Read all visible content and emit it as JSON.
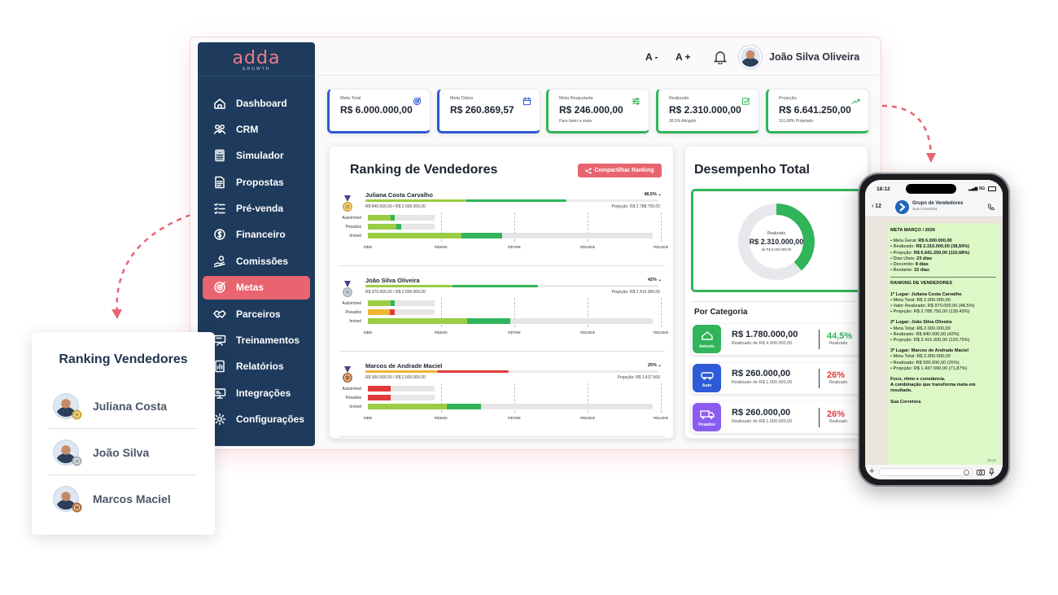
{
  "brand": {
    "name": "adda",
    "tagline": "GROWTH"
  },
  "sidebar": {
    "items": [
      {
        "label": "Dashboard",
        "icon": "home-icon"
      },
      {
        "label": "CRM",
        "icon": "users-icon"
      },
      {
        "label": "Simulador",
        "icon": "calculator-icon"
      },
      {
        "label": "Propostas",
        "icon": "document-icon"
      },
      {
        "label": "Pré-venda",
        "icon": "checklist-icon"
      },
      {
        "label": "Financeiro",
        "icon": "money-icon"
      },
      {
        "label": "Comissões",
        "icon": "hand-coin-icon"
      },
      {
        "label": "Metas",
        "icon": "target-icon",
        "active": true
      },
      {
        "label": "Parceiros",
        "icon": "handshake-icon"
      },
      {
        "label": "Treinamentos",
        "icon": "training-icon"
      },
      {
        "label": "Relatórios",
        "icon": "report-icon"
      },
      {
        "label": "Integrações",
        "icon": "integration-icon"
      },
      {
        "label": "Configurações",
        "icon": "gear-icon"
      }
    ]
  },
  "topbar": {
    "font_decrease": "A -",
    "font_increase": "A +",
    "user_name": "João Silva Oliveira"
  },
  "kpis": [
    {
      "label": "Meta Total",
      "value": "R$ 6.000.000,00",
      "sub": "",
      "icon": "target-icon",
      "accent": "#2d5bd7"
    },
    {
      "label": "Meta Diária",
      "value": "R$ 260.869,57",
      "sub": "",
      "icon": "calendar-icon",
      "accent": "#2d5bd7"
    },
    {
      "label": "Meta Reajustada",
      "value": "R$ 246.000,00",
      "sub": "Para bater a meta",
      "icon": "sliders-icon",
      "accent": "#31b45a"
    },
    {
      "label": "Realizado",
      "value": "R$ 2.310.000,00",
      "sub": "38,5% Atingido",
      "icon": "check-icon",
      "accent": "#31b45a"
    },
    {
      "label": "Projeção",
      "value": "R$ 6.641.250,00",
      "sub": "110,68% Projetado",
      "icon": "trend-up-icon",
      "accent": "#31b45a"
    }
  ],
  "ranking": {
    "title": "Ranking de Vendedores",
    "share_label": "Compartilhar Ranking",
    "axis_ticks": [
      "R$0k",
      "R$350K",
      "R$700k",
      "R$1050k",
      "R$1400k"
    ],
    "axis_max": 1400,
    "categories": [
      "Automóvel",
      "Pesados",
      "Imóvel"
    ],
    "sellers": [
      {
        "name": "Juliana Costa Carvalho",
        "pct": "48,5%",
        "progress": 0.685,
        "meta": "R$ 840.000,00 / R$ 2.000.000,00",
        "proj": "Projeção: R$ 2.788.750,00",
        "medal": "gold",
        "bars": [
          {
            "goal": 320,
            "done": 130
          },
          {
            "goal": 320,
            "done": 160
          },
          {
            "goal": 1360,
            "done": 640
          }
        ]
      },
      {
        "name": "João Silva Oliveira",
        "pct": "42%",
        "progress": 0.59,
        "meta": "R$ 970.000,00 / R$ 2.000.000,00",
        "proj": "Projeção: R$ 2.415.000,00",
        "medal": "silver",
        "bars": [
          {
            "goal": 320,
            "done": 130
          },
          {
            "goal": 320,
            "done": 130
          },
          {
            "goal": 1360,
            "done": 680
          }
        ]
      },
      {
        "name": "Marcos de Andrade Maciel",
        "pct": "25%",
        "progress": 0.49,
        "meta": "R$ 500.000,00 / R$ 2.000.000,00",
        "proj": "Projeção: R$ 1.437.500",
        "medal": "bronze",
        "bars": [
          {
            "goal": 320,
            "done": 110
          },
          {
            "goal": 320,
            "done": 110
          },
          {
            "goal": 1360,
            "done": 540
          }
        ]
      }
    ]
  },
  "desempenho": {
    "title": "Desempenho Total",
    "donut_label": "Realizado",
    "donut_value": "R$ 2.310.000,00",
    "donut_sub": "de R$ 6.000.000,00",
    "donut_fraction": 0.385,
    "category_title": "Por Categoria",
    "categories": [
      {
        "name": "Imóveis",
        "amount": "R$ 1.780.000,00",
        "meta": "Realizado de R$ 4.000.000,00",
        "pct": "44,5%",
        "pct_label": "Realizado",
        "color": "#31b45a",
        "pct_color": "#31b45a"
      },
      {
        "name": "Auto",
        "amount": "R$ 260.000,00",
        "meta": "Realizado de R$ 1.000.000,00",
        "pct": "26%",
        "pct_label": "Realizado",
        "color": "#2d5bd7",
        "pct_color": "#e03b3b"
      },
      {
        "name": "Pesados",
        "amount": "R$ 260.000,00",
        "meta": "Realizado de R$ 1.000.000,00",
        "pct": "26%",
        "pct_label": "Realizado",
        "color": "#8a5cf0",
        "pct_color": "#e03b3b"
      }
    ]
  },
  "float_card": {
    "title": "Ranking Vendedores",
    "rows": [
      {
        "name": "Juliana Costa",
        "medal": "gold"
      },
      {
        "name": "João Silva",
        "medal": "silver"
      },
      {
        "name": "Marcos Maciel",
        "medal": "bronze"
      }
    ]
  },
  "phone": {
    "time": "18:12",
    "network": "5G",
    "back_count": "12",
    "group_name": "Grupo de Vendedores",
    "group_sub": "Sua Corretora",
    "message_time": "18:12",
    "message": {
      "title": "META MARÇO / 2026",
      "summary": [
        {
          "label": "• Meta Geral: ",
          "value": "R$ 6.000.000,00"
        },
        {
          "label": "• Realizado: ",
          "value": "R$ 2.310.000,00  (38,50%)"
        },
        {
          "label": "• Projeção: ",
          "value": "R$ 6.641.250,00  (110,68%)"
        },
        {
          "label": "• Dias Úteis: ",
          "value": "23 dias"
        },
        {
          "label": "• Decorrido: ",
          "value": "8 dias"
        },
        {
          "label": "• Restante: ",
          "value": "15 dias"
        }
      ],
      "ranking_title": "RANKING DE VENDEDORES",
      "places": [
        {
          "title": "1º Lugar: Juliana Costa Carvalho",
          "lines": [
            "• Meta Total: R$ 2.000.000,00",
            "• Valor Realizado: R$ 970.000,00 (48,5%)",
            "• Projeção: R$ 2.788.750,00 (139,43%)"
          ]
        },
        {
          "title": "2º Lugar: João Silva Oliveira",
          "lines": [
            "• Meta Total: R$ 2.000.000,00",
            "• Realizado: R$ 840.000,00 (42%)",
            "• Projeção: R$ 2.415.000,00 (120,75%)"
          ]
        },
        {
          "title": "3º Lugar: Marcos de Andrade Maciel",
          "lines": [
            "• Meta Total: R$ 2.000.000,00",
            "• Realizado: R$ 500.000,00 (25%)",
            "• Projeção: R$ 1.437.500,00 (71,87%)"
          ]
        }
      ],
      "closing_1": "Foco, ritmo e constância.",
      "closing_2": "A combinação que transforma meta em resultado.",
      "signature": "Sua Corretora"
    }
  }
}
